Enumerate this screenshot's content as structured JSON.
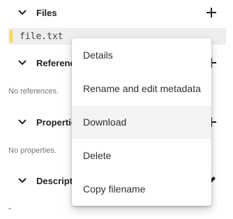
{
  "sections": {
    "files": {
      "title": "Files",
      "action_icon": "plus-icon"
    },
    "references": {
      "title": "References",
      "empty_text": "No references.",
      "action_icon": "plus-icon"
    },
    "properties": {
      "title": "Properties",
      "empty_text": "No properties.",
      "action_icon": "plus-icon"
    },
    "description": {
      "title": "Description",
      "value": "-",
      "action_icon": "pencil-icon"
    }
  },
  "file": {
    "name": "file.txt",
    "marker_color": "#fdd835"
  },
  "context_menu": {
    "items": [
      {
        "label": "Details"
      },
      {
        "label": "Rename and edit metadata"
      },
      {
        "label": "Download",
        "highlighted": true
      },
      {
        "label": "Delete"
      },
      {
        "label": "Copy filename"
      }
    ]
  }
}
